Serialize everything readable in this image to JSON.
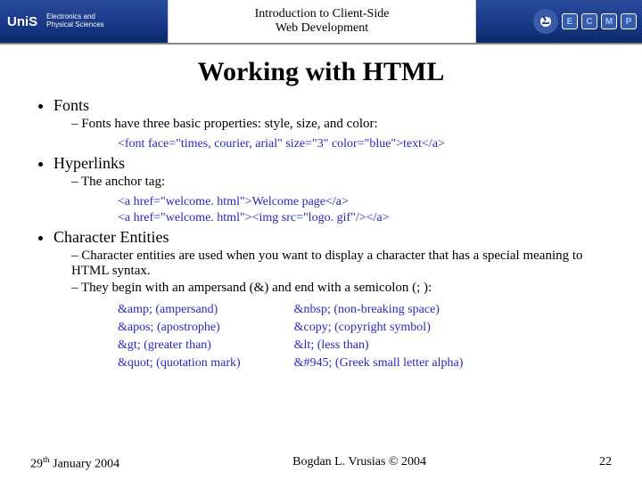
{
  "banner": {
    "logo": "UniS",
    "dept_line1": "Electronics and",
    "dept_line2": "Physical Sciences",
    "title_line1": "Introduction to Client-Side",
    "title_line2": "Web Development",
    "sigma": "Σ",
    "badges": [
      "E",
      "C",
      "M",
      "P"
    ]
  },
  "title": "Working with HTML",
  "bullets": {
    "fonts": {
      "label": "Fonts",
      "sub1": "Fonts have three basic properties: style, size, and color:",
      "code": "<font face=\"times, courier, arial\" size=\"3\" color=\"blue\">text</a>"
    },
    "hyperlinks": {
      "label": "Hyperlinks",
      "sub1": "The anchor tag:",
      "code1": "<a href=\"welcome. html\">Welcome page</a>",
      "code2": "<a href=\"welcome. html\"><img src=\"logo. gif\"/></a>"
    },
    "entities": {
      "label": "Character Entities",
      "sub1": "Character entities are used when you want to display a character that has a special meaning to HTML syntax.",
      "sub2": "They begin with an ampersand (&) and end with a semicolon (; ):",
      "left": [
        "&amp; (ampersand)",
        "&apos; (apostrophe)",
        "&gt; (greater than)",
        "&quot; (quotation mark)"
      ],
      "right": [
        "&nbsp; (non-breaking space)",
        "&copy; (copyright symbol)",
        "&lt; (less than)",
        "&#945; (Greek small letter alpha)"
      ]
    }
  },
  "footer": {
    "date_prefix": "29",
    "date_sup": "th",
    "date_suffix": " January 2004",
    "author": "Bogdan L. Vrusias © 2004",
    "page": "22"
  }
}
